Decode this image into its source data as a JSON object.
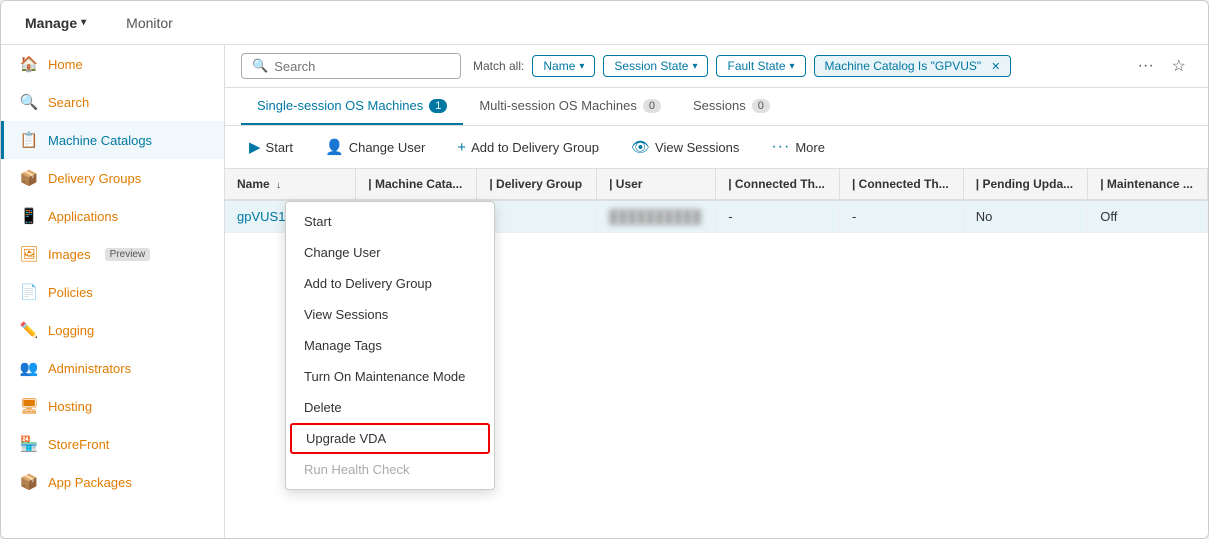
{
  "topNav": {
    "manage_label": "Manage",
    "monitor_label": "Monitor"
  },
  "sidebar": {
    "items": [
      {
        "id": "home",
        "label": "Home",
        "icon": "🏠",
        "color": "orange"
      },
      {
        "id": "search",
        "label": "Search",
        "icon": "🔍",
        "color": "orange"
      },
      {
        "id": "machine-catalogs",
        "label": "Machine Catalogs",
        "icon": "📋",
        "color": "teal",
        "active": true
      },
      {
        "id": "delivery-groups",
        "label": "Delivery Groups",
        "icon": "📦",
        "color": "orange"
      },
      {
        "id": "applications",
        "label": "Applications",
        "icon": "📱",
        "color": "orange"
      },
      {
        "id": "images",
        "label": "Images",
        "icon": "🖼",
        "color": "orange",
        "badge": "Preview"
      },
      {
        "id": "policies",
        "label": "Policies",
        "icon": "📄",
        "color": "orange"
      },
      {
        "id": "logging",
        "label": "Logging",
        "icon": "✏️",
        "color": "orange"
      },
      {
        "id": "administrators",
        "label": "Administrators",
        "icon": "👥",
        "color": "orange"
      },
      {
        "id": "hosting",
        "label": "Hosting",
        "icon": "🖥",
        "color": "orange"
      },
      {
        "id": "storefront",
        "label": "StoreFront",
        "icon": "🏪",
        "color": "orange"
      },
      {
        "id": "app-packages",
        "label": "App Packages",
        "icon": "📦",
        "color": "orange"
      }
    ]
  },
  "filterBar": {
    "search_placeholder": "Search",
    "match_all_label": "Match all:",
    "filters": [
      {
        "id": "name",
        "label": "Name",
        "has_chevron": true
      },
      {
        "id": "session-state",
        "label": "Session State",
        "has_chevron": true
      },
      {
        "id": "fault-state",
        "label": "Fault State",
        "has_chevron": true
      },
      {
        "id": "machine-catalog",
        "label": "Machine Catalog Is \"GPVUS\"",
        "closeable": true
      }
    ]
  },
  "tabs": [
    {
      "id": "single-session",
      "label": "Single-session OS Machines",
      "count": 1,
      "active": true
    },
    {
      "id": "multi-session",
      "label": "Multi-session OS Machines",
      "count": 0
    },
    {
      "id": "sessions",
      "label": "Sessions",
      "count": 0
    }
  ],
  "actionBar": {
    "buttons": [
      {
        "id": "start",
        "label": "Start",
        "icon": "▶"
      },
      {
        "id": "change-user",
        "label": "Change User",
        "icon": "👤"
      },
      {
        "id": "add-to-delivery-group",
        "label": "Add to Delivery Group",
        "icon": "+"
      },
      {
        "id": "view-sessions",
        "label": "View Sessions",
        "icon": "👁"
      },
      {
        "id": "more",
        "label": "More",
        "icon": "···"
      }
    ]
  },
  "table": {
    "columns": [
      {
        "id": "name",
        "label": "Name",
        "sortable": true
      },
      {
        "id": "machine-catalog",
        "label": "Machine Cata..."
      },
      {
        "id": "delivery-group",
        "label": "Delivery Group"
      },
      {
        "id": "user",
        "label": "User"
      },
      {
        "id": "connected-th1",
        "label": "Connected Th..."
      },
      {
        "id": "connected-th2",
        "label": "Connected Th..."
      },
      {
        "id": "pending-upda",
        "label": "Pending Upda..."
      },
      {
        "id": "maintenance",
        "label": "Maintenance ..."
      }
    ],
    "rows": [
      {
        "name": "gpVUS1.studio.l...",
        "machine_catalog": "",
        "delivery_group": "",
        "user": "██████████",
        "connected_th1": "-",
        "connected_th2": "-",
        "pending_upda": "No",
        "maintenance": "Off",
        "selected": true
      }
    ]
  },
  "contextMenu": {
    "items": [
      {
        "id": "start",
        "label": "Start",
        "highlighted": false,
        "disabled": false
      },
      {
        "id": "change-user",
        "label": "Change User",
        "highlighted": false,
        "disabled": false
      },
      {
        "id": "add-to-delivery-group",
        "label": "Add to Delivery Group",
        "highlighted": false,
        "disabled": false
      },
      {
        "id": "view-sessions",
        "label": "View Sessions",
        "highlighted": false,
        "disabled": false
      },
      {
        "id": "manage-tags",
        "label": "Manage Tags",
        "highlighted": false,
        "disabled": false
      },
      {
        "id": "turn-on-maintenance",
        "label": "Turn On Maintenance Mode",
        "highlighted": false,
        "disabled": false
      },
      {
        "id": "delete",
        "label": "Delete",
        "highlighted": false,
        "disabled": false
      },
      {
        "id": "upgrade-vda",
        "label": "Upgrade VDA",
        "highlighted": true,
        "disabled": false
      },
      {
        "id": "run-health-check",
        "label": "Run Health Check",
        "highlighted": false,
        "disabled": true
      }
    ]
  }
}
